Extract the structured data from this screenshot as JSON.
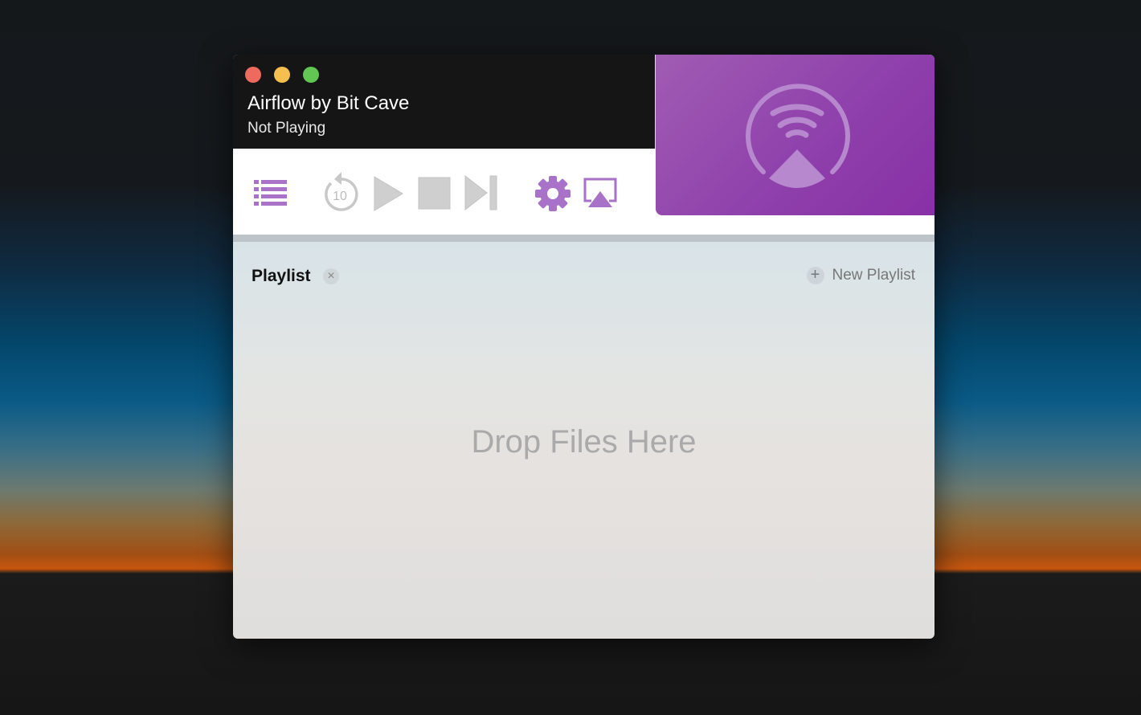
{
  "window": {
    "title": "Airflow by Bit Cave",
    "status": "Not Playing"
  },
  "toolbar": {
    "buttons": [
      {
        "name": "playlist-toggle",
        "icon": "list-icon"
      },
      {
        "name": "skip-back-10",
        "icon": "rewind-10-icon",
        "label": "10"
      },
      {
        "name": "play",
        "icon": "play-icon"
      },
      {
        "name": "stop",
        "icon": "stop-icon"
      },
      {
        "name": "next",
        "icon": "skip-next-icon"
      },
      {
        "name": "settings",
        "icon": "gear-icon"
      },
      {
        "name": "airplay",
        "icon": "airplay-icon"
      }
    ]
  },
  "playlist": {
    "title": "Playlist",
    "close": "×",
    "new_label": "New Playlist",
    "new_icon": "+",
    "empty_text": "Drop Files Here"
  },
  "colors": {
    "accent": "#a872c9",
    "disabled": "#c8c8c8",
    "art": "#9245ad"
  }
}
